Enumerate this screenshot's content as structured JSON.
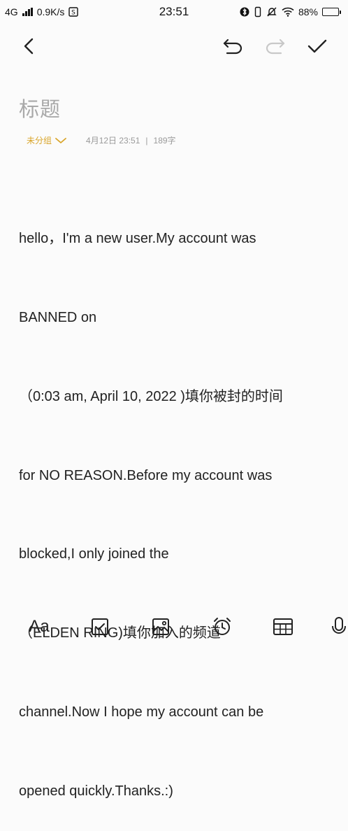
{
  "status_bar": {
    "network": "4G",
    "speed": "0.9K/s",
    "time": "23:51",
    "battery": "88%",
    "battery_level": 0.88
  },
  "toolbar": {
    "back_icon": "chevron-left-icon",
    "undo_icon": "undo-icon",
    "redo_icon": "redo-icon",
    "done_icon": "checkmark-icon"
  },
  "note": {
    "title_placeholder": "标题",
    "group": "未分组",
    "date": "4月12日 23:51",
    "separator": "|",
    "word_count": "189字",
    "body_lines": [
      "hello，I'm a new user.My account was",
      "BANNED on",
      "（0:03 am, April 10, 2022 )填你被封的时间",
      "for NO REASON.Before my account was",
      "blocked,I only joined the",
      "（ELDEN RING)填你加入的频道",
      "channel.Now I hope my account can be",
      "opened quickly.Thanks.:)"
    ]
  },
  "bottom_bar": {
    "font_label": "Aa",
    "items": [
      "font-format-icon",
      "checklist-icon",
      "image-icon",
      "alarm-icon",
      "table-icon",
      "microphone-icon"
    ]
  },
  "colors": {
    "accent": "#d9a52a",
    "background": "#fbfbfb",
    "text": "#222222",
    "muted": "#9a9a9a",
    "disabled": "#c8c8c8"
  }
}
